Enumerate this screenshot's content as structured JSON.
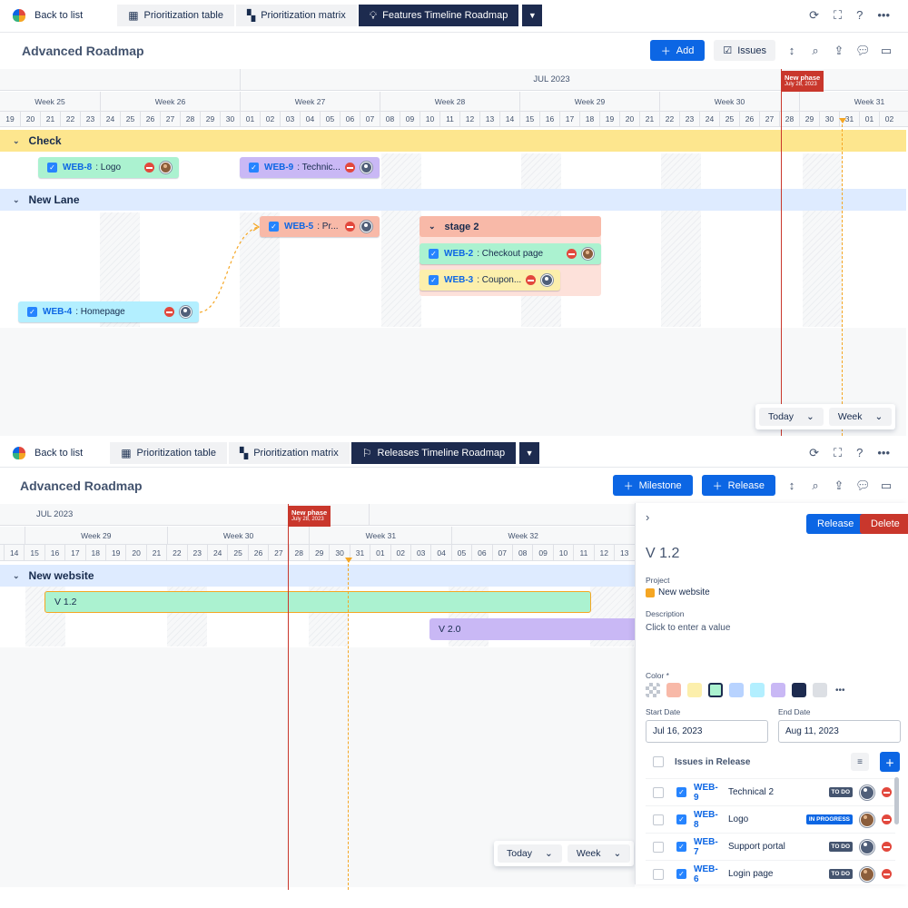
{
  "top": {
    "nav": {
      "back": "Back to list",
      "tabs": [
        "Prioritization table",
        "Prioritization matrix",
        "Features Timeline Roadmap"
      ]
    },
    "title": "Advanced Roadmap",
    "actions": {
      "add": "Add",
      "issues": "Issues"
    },
    "month": "JUL 2023",
    "weeks": [
      "Week 25",
      "Week 26",
      "Week 27",
      "Week 28",
      "Week 29",
      "Week 30",
      "Week 31"
    ],
    "days": [
      "19",
      "20",
      "21",
      "22",
      "23",
      "24",
      "25",
      "26",
      "27",
      "28",
      "29",
      "30",
      "01",
      "02",
      "03",
      "04",
      "05",
      "06",
      "07",
      "08",
      "09",
      "10",
      "11",
      "12",
      "13",
      "14",
      "15",
      "16",
      "17",
      "18",
      "19",
      "20",
      "21",
      "22",
      "23",
      "24",
      "25",
      "26",
      "27",
      "28",
      "29",
      "30",
      "31",
      "01",
      "02"
    ],
    "phase": {
      "label": "New phase",
      "date": "July 28, 2023"
    },
    "lanes": [
      {
        "name": "Check"
      },
      {
        "name": "New Lane"
      }
    ],
    "group": {
      "name": "stage 2"
    },
    "cards": [
      {
        "key": "WEB-8",
        "title": ": Logo"
      },
      {
        "key": "WEB-9",
        "title": ": Technic..."
      },
      {
        "key": "WEB-5",
        "title": ": Pr..."
      },
      {
        "key": "WEB-2",
        "title": ": Checkout page"
      },
      {
        "key": "WEB-3",
        "title": ": Coupon..."
      },
      {
        "key": "WEB-4",
        "title": ": Homepage"
      }
    ],
    "zoom": {
      "today": "Today",
      "scale": "Week"
    }
  },
  "bottom": {
    "nav": {
      "back": "Back to list",
      "tabs": [
        "Prioritization table",
        "Prioritization matrix",
        "Releases Timeline Roadmap"
      ]
    },
    "title": "Advanced Roadmap",
    "actions": {
      "milestone": "Milestone",
      "release": "Release"
    },
    "month": "JUL 2023",
    "weeks": [
      "Week 29",
      "Week 30",
      "Week 31",
      "Week 32"
    ],
    "days": [
      "14",
      "15",
      "16",
      "17",
      "18",
      "19",
      "20",
      "21",
      "22",
      "23",
      "24",
      "25",
      "26",
      "27",
      "28",
      "29",
      "30",
      "31",
      "01",
      "02",
      "03",
      "04",
      "05",
      "06",
      "07",
      "08",
      "09",
      "10",
      "11",
      "12",
      "13"
    ],
    "phase": {
      "label": "New phase",
      "date": "July 28, 2023"
    },
    "lane": {
      "name": "New website"
    },
    "releases": [
      {
        "name": "V 1.2"
      },
      {
        "name": "V 2.0"
      }
    ],
    "zoom": {
      "today": "Today",
      "scale": "Week"
    },
    "drawer": {
      "release_btn": "Release",
      "delete_btn": "Delete",
      "name": "V 1.2",
      "project_label": "Project",
      "project": "New website",
      "description_label": "Description",
      "description": "Click to enter a value",
      "color_label": "Color *",
      "colors": [
        "#f8b9a8",
        "#fcefac",
        "#abf2d0",
        "#b8d3ff",
        "#b3efff",
        "#c9b8f5",
        "#1d2b4f",
        "#dcdfe4"
      ],
      "selected_color": "#abf2d0",
      "start_label": "Start Date",
      "start": "Jul 16, 2023",
      "end_label": "End Date",
      "end": "Aug 11, 2023",
      "issues_label": "Issues in Release",
      "issues": [
        {
          "key": "WEB-9",
          "title": "Technical 2",
          "status": "TO DO"
        },
        {
          "key": "WEB-8",
          "title": "Logo",
          "status": "IN PROGRESS"
        },
        {
          "key": "WEB-7",
          "title": "Support portal",
          "status": "TO DO"
        },
        {
          "key": "WEB-6",
          "title": "Login page",
          "status": "TO DO"
        }
      ]
    }
  }
}
